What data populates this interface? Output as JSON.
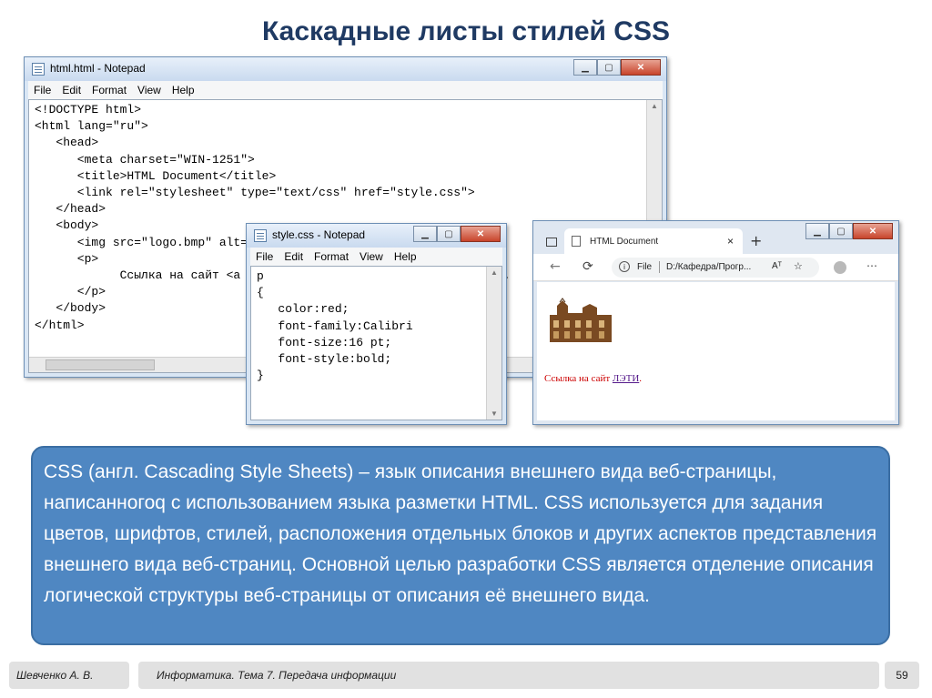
{
  "slide": {
    "title": "Каскадные листы стилей CSS",
    "description": "CSS (англ. Cascading Style Sheets) – язык описания внешнего вида веб-страницы, написанногоq с использованием языка разметки HTML. CSS используется для задания цветов, шрифтов, стилей, расположения отдельных блоков и других аспектов представления внешнего вида веб-страниц. Основной целью разработки CSS является отделение описания логической структуры веб-страницы от описания её внешнего вида."
  },
  "html_notepad": {
    "title": "html.html - Notepad",
    "menu": [
      "File",
      "Edit",
      "Format",
      "View",
      "Help"
    ],
    "code": "<!DOCTYPE html>\n<html lang=\"ru\">\n   <head>\n      <meta charset=\"WIN-1251\">\n      <title>HTML Document</title>\n      <link rel=\"stylesheet\" type=\"text/css\" href=\"style.css\">\n   </head>\n   <body>\n      <img src=\"logo.bmp\" alt=\"Логотип ЛЭТИ\" align=\"left\">\n      <p>\n            Ссылка на сайт <a href=\"http://www.eltech.ru\">ЛЭТИ</a>.\n      </p>\n   </body>\n</html>"
  },
  "css_notepad": {
    "title": "style.css - Notepad",
    "menu": [
      "File",
      "Edit",
      "Format",
      "View",
      "Help"
    ],
    "code": "p\n{\n   color:red;\n   font-family:Calibri\n   font-size:16 pt;\n   font-style:bold;\n}"
  },
  "browser": {
    "tab_title": "HTML Document",
    "tab_close": "×",
    "new_tab": "+",
    "address_prefix": "File",
    "address": "D:/Кафедра/Прогр...",
    "read_aloud": "Aᵀ",
    "page_text": "Ссылка на сайт ",
    "link_text": "ЛЭТИ",
    "page_text_end": "."
  },
  "footer": {
    "author": "Шевченко А. В.",
    "course": "Информатика. Тема 7. Передача информации",
    "page_number": "59"
  },
  "colors": {
    "title": "#1f3a63",
    "infobox": "#4f87c2",
    "page_text": "#cc0000",
    "link": "#551a8b"
  }
}
